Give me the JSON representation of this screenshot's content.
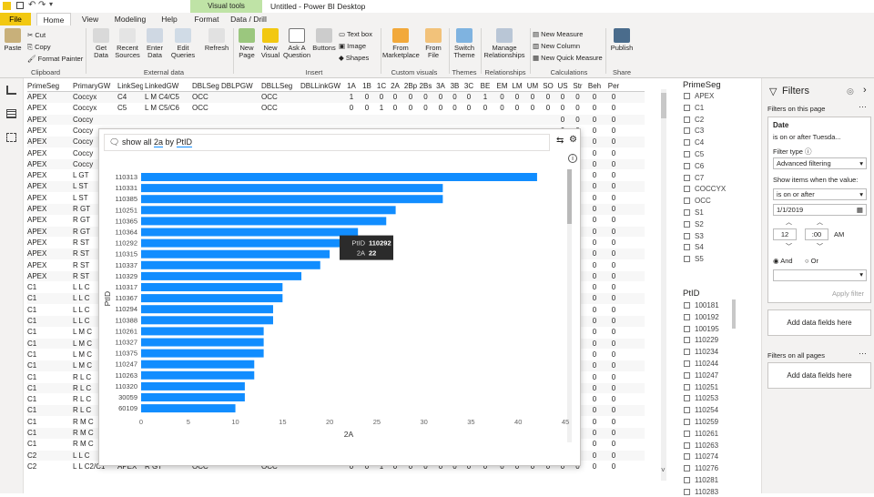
{
  "title_bar": {
    "document_title": "Untitled - Power BI Desktop",
    "visual_tools": "Visual tools"
  },
  "ribbon_tabs": [
    "File",
    "Home",
    "View",
    "Modeling",
    "Help",
    "Format",
    "Data / Drill"
  ],
  "ribbon": {
    "clipboard": {
      "paste": "Paste",
      "cut": "Cut",
      "copy": "Copy",
      "format_painter": "Format Painter",
      "group": "Clipboard"
    },
    "external": {
      "get_data": "Get Data",
      "recent": "Recent Sources",
      "enter": "Enter Data",
      "edit": "Edit Queries",
      "refresh": "Refresh",
      "group": "External data"
    },
    "insert": {
      "new_page": "New Page",
      "new_visual": "New Visual",
      "ask": "Ask A Question",
      "buttons": "Buttons",
      "text_box": "Text box",
      "image": "Image",
      "shapes": "Shapes",
      "group": "Insert"
    },
    "custom": {
      "marketplace": "From Marketplace",
      "file": "From File",
      "group": "Custom visuals"
    },
    "themes": {
      "switch": "Switch Theme",
      "group": "Themes"
    },
    "relationships": {
      "manage": "Manage Relationships",
      "group": "Relationships"
    },
    "calculations": {
      "new_measure": "New Measure",
      "new_column": "New Column",
      "new_quick": "New Quick Measure",
      "group": "Calculations"
    },
    "share": {
      "publish": "Publish",
      "group": "Share"
    }
  },
  "table": {
    "headers": [
      "PrimeSeg",
      "PrimaryGW",
      "LinkSeg",
      "LinkedGW",
      "DBLSeg",
      "DBLPGW",
      "DBLLSeg",
      "DBLLinkGW",
      "1A",
      "1B",
      "1C",
      "2A",
      "2Bp",
      "2Bs",
      "3A",
      "3B",
      "3C",
      "BE",
      "EM",
      "LM",
      "UM",
      "SO",
      "US",
      "Str",
      "Beh",
      "Per"
    ],
    "rows": [
      [
        "APEX",
        "Coccyx",
        "C4",
        "L M C4/C5",
        "OCC",
        "",
        "OCC",
        "",
        "1",
        "0",
        "0",
        "0",
        "0",
        "0",
        "0",
        "0",
        "0",
        "1",
        "0",
        "0",
        "0",
        "0",
        "0",
        "0",
        "0",
        "0"
      ],
      [
        "APEX",
        "Coccyx",
        "C5",
        "L M C5/C6",
        "OCC",
        "",
        "OCC",
        "",
        "0",
        "0",
        "1",
        "0",
        "0",
        "0",
        "0",
        "0",
        "0",
        "0",
        "0",
        "0",
        "0",
        "0",
        "0",
        "0",
        "0",
        "0"
      ],
      [
        "APEX",
        "Coccy",
        "",
        "",
        "",
        "",
        "",
        "",
        "",
        "",
        "",
        "",
        "",
        "",
        "",
        "",
        "",
        "",
        "",
        "",
        "",
        "",
        "0",
        "0",
        "0",
        "0"
      ],
      [
        "APEX",
        "Coccy",
        "",
        "",
        "",
        "",
        "",
        "",
        "",
        "",
        "",
        "",
        "",
        "",
        "",
        "",
        "",
        "",
        "",
        "",
        "",
        "",
        "0",
        "0",
        "0",
        "0"
      ],
      [
        "APEX",
        "Coccy",
        "",
        "",
        "",
        "",
        "",
        "",
        "",
        "",
        "",
        "",
        "",
        "",
        "",
        "",
        "",
        "",
        "",
        "",
        "",
        "",
        "0",
        "0",
        "0",
        "0"
      ],
      [
        "APEX",
        "Coccy",
        "",
        "",
        "",
        "",
        "",
        "",
        "",
        "",
        "",
        "",
        "",
        "",
        "",
        "",
        "",
        "",
        "",
        "",
        "",
        "",
        "0",
        "0",
        "0",
        "0"
      ],
      [
        "APEX",
        "Coccy",
        "",
        "",
        "",
        "",
        "",
        "",
        "",
        "",
        "",
        "",
        "",
        "",
        "",
        "",
        "",
        "",
        "",
        "",
        "",
        "",
        "0",
        "0",
        "0",
        "0"
      ],
      [
        "APEX",
        "L GT",
        "",
        "",
        "",
        "",
        "",
        "",
        "",
        "",
        "",
        "",
        "",
        "",
        "",
        "",
        "",
        "",
        "",
        "",
        "",
        "",
        "0",
        "0",
        "0",
        "0"
      ],
      [
        "APEX",
        "L ST",
        "",
        "",
        "",
        "",
        "",
        "",
        "",
        "",
        "",
        "",
        "",
        "",
        "",
        "",
        "",
        "",
        "",
        "",
        "",
        "",
        "0",
        "0",
        "0",
        "0"
      ],
      [
        "APEX",
        "L ST",
        "",
        "",
        "",
        "",
        "",
        "",
        "",
        "",
        "",
        "",
        "",
        "",
        "",
        "",
        "",
        "",
        "",
        "",
        "",
        "",
        "0",
        "0",
        "0",
        "0"
      ],
      [
        "APEX",
        "R GT",
        "",
        "",
        "",
        "",
        "",
        "",
        "",
        "",
        "",
        "",
        "",
        "",
        "",
        "",
        "",
        "",
        "",
        "",
        "",
        "",
        "0",
        "0",
        "0",
        "0"
      ],
      [
        "APEX",
        "R GT",
        "",
        "",
        "",
        "",
        "",
        "",
        "",
        "",
        "",
        "",
        "",
        "",
        "",
        "",
        "",
        "",
        "",
        "",
        "",
        "",
        "0",
        "0",
        "0",
        "0"
      ],
      [
        "APEX",
        "R GT",
        "",
        "",
        "",
        "",
        "",
        "",
        "",
        "",
        "",
        "",
        "",
        "",
        "",
        "",
        "",
        "",
        "",
        "",
        "",
        "",
        "0",
        "0",
        "0",
        "0"
      ],
      [
        "APEX",
        "R ST",
        "",
        "",
        "",
        "",
        "",
        "",
        "",
        "",
        "",
        "",
        "",
        "",
        "",
        "",
        "",
        "",
        "",
        "",
        "",
        "",
        "0",
        "0",
        "0",
        "0"
      ],
      [
        "APEX",
        "R ST",
        "",
        "",
        "",
        "",
        "",
        "",
        "",
        "",
        "",
        "",
        "",
        "",
        "",
        "",
        "",
        "",
        "",
        "",
        "",
        "",
        "0",
        "0",
        "0",
        "0"
      ],
      [
        "APEX",
        "R ST",
        "",
        "",
        "",
        "",
        "",
        "",
        "",
        "",
        "",
        "",
        "",
        "",
        "",
        "",
        "",
        "",
        "",
        "",
        "",
        "",
        "0",
        "0",
        "0",
        "0"
      ],
      [
        "APEX",
        "R ST",
        "",
        "",
        "",
        "",
        "",
        "",
        "",
        "",
        "",
        "",
        "",
        "",
        "",
        "",
        "",
        "",
        "",
        "",
        "",
        "",
        "0",
        "0",
        "0",
        "0"
      ],
      [
        "C1",
        "L L C",
        "",
        "",
        "",
        "",
        "",
        "",
        "",
        "",
        "",
        "",
        "",
        "",
        "",
        "",
        "",
        "",
        "",
        "",
        "",
        "",
        "0",
        "0",
        "0",
        "0"
      ],
      [
        "C1",
        "L L C",
        "",
        "",
        "",
        "",
        "",
        "",
        "",
        "",
        "",
        "",
        "",
        "",
        "",
        "",
        "",
        "",
        "",
        "",
        "",
        "",
        "0",
        "0",
        "0",
        "0"
      ],
      [
        "C1",
        "L L C",
        "",
        "",
        "",
        "",
        "",
        "",
        "",
        "",
        "",
        "",
        "",
        "",
        "",
        "",
        "",
        "",
        "",
        "",
        "",
        "",
        "0",
        "0",
        "0",
        "0"
      ],
      [
        "C1",
        "L L C",
        "",
        "",
        "",
        "",
        "",
        "",
        "",
        "",
        "",
        "",
        "",
        "",
        "",
        "",
        "",
        "",
        "",
        "",
        "",
        "",
        "0",
        "0",
        "0",
        "0"
      ],
      [
        "C1",
        "L M C",
        "",
        "",
        "",
        "",
        "",
        "",
        "",
        "",
        "",
        "",
        "",
        "",
        "",
        "",
        "",
        "",
        "",
        "",
        "",
        "",
        "0",
        "0",
        "0",
        "0"
      ],
      [
        "C1",
        "L M C",
        "",
        "",
        "",
        "",
        "",
        "",
        "",
        "",
        "",
        "",
        "",
        "",
        "",
        "",
        "",
        "",
        "",
        "",
        "",
        "",
        "0",
        "0",
        "0",
        "0"
      ],
      [
        "C1",
        "L M C",
        "",
        "",
        "",
        "",
        "",
        "",
        "",
        "",
        "",
        "",
        "",
        "",
        "",
        "",
        "",
        "",
        "",
        "",
        "",
        "",
        "0",
        "0",
        "0",
        "0"
      ],
      [
        "C1",
        "L M C",
        "",
        "",
        "",
        "",
        "",
        "",
        "",
        "",
        "",
        "",
        "",
        "",
        "",
        "",
        "",
        "",
        "",
        "",
        "",
        "",
        "0",
        "0",
        "0",
        "0"
      ],
      [
        "C1",
        "R L C",
        "",
        "",
        "",
        "",
        "",
        "",
        "",
        "",
        "",
        "",
        "",
        "",
        "",
        "",
        "",
        "",
        "",
        "",
        "",
        "",
        "0",
        "0",
        "0",
        "0"
      ],
      [
        "C1",
        "R L C",
        "",
        "",
        "",
        "",
        "",
        "",
        "",
        "",
        "",
        "",
        "",
        "",
        "",
        "",
        "",
        "",
        "",
        "",
        "",
        "",
        "0",
        "0",
        "0",
        "0"
      ],
      [
        "C1",
        "R L C",
        "",
        "",
        "",
        "",
        "",
        "",
        "",
        "",
        "",
        "",
        "",
        "",
        "",
        "",
        "",
        "",
        "",
        "",
        "",
        "",
        "0",
        "0",
        "0",
        "0"
      ],
      [
        "C1",
        "R L C",
        "",
        "",
        "",
        "",
        "",
        "",
        "",
        "",
        "",
        "",
        "",
        "",
        "",
        "",
        "",
        "",
        "",
        "",
        "",
        "",
        "0",
        "0",
        "0",
        "0"
      ],
      [
        "C1",
        "R M C",
        "",
        "",
        "",
        "",
        "",
        "",
        "",
        "",
        "",
        "",
        "",
        "",
        "",
        "",
        "",
        "",
        "",
        "",
        "",
        "",
        "0",
        "0",
        "0",
        "0"
      ],
      [
        "C1",
        "R M C",
        "",
        "",
        "",
        "",
        "",
        "",
        "",
        "",
        "",
        "",
        "",
        "",
        "",
        "",
        "",
        "",
        "",
        "",
        "",
        "",
        "0",
        "0",
        "0",
        "0"
      ],
      [
        "C1",
        "R M C",
        "",
        "",
        "",
        "",
        "",
        "",
        "",
        "",
        "",
        "",
        "",
        "",
        "",
        "",
        "",
        "",
        "",
        "",
        "",
        "",
        "0",
        "0",
        "0",
        "0"
      ],
      [
        "C2",
        "L L C",
        "",
        "",
        "",
        "",
        "",
        "",
        "",
        "",
        "",
        "",
        "",
        "",
        "",
        "",
        "",
        "",
        "",
        "",
        "",
        "",
        "0",
        "0",
        "0",
        "0"
      ],
      [
        "C2",
        "L L C2/C1",
        "APEX",
        "R GT",
        "OCC",
        "",
        "OCC",
        "",
        "0",
        "0",
        "1",
        "0",
        "0",
        "0",
        "0",
        "0",
        "0",
        "0",
        "0",
        "0",
        "0",
        "0",
        "0",
        "0",
        "0",
        "0"
      ]
    ]
  },
  "qa": {
    "query_prefix": "show all",
    "query_measure": "2a",
    "query_by": "by",
    "query_field": "PtID"
  },
  "chart_data": {
    "type": "bar",
    "orientation": "horizontal",
    "categories": [
      "110313",
      "110331",
      "110385",
      "110251",
      "110365",
      "110364",
      "110292",
      "110315",
      "110337",
      "110329",
      "110317",
      "110367",
      "110294",
      "110388",
      "110261",
      "110327",
      "110375",
      "110247",
      "110263",
      "110320",
      "30059",
      "60109"
    ],
    "values": [
      42,
      32,
      32,
      27,
      26,
      23,
      22,
      20,
      19,
      17,
      15,
      15,
      14,
      14,
      13,
      13,
      13,
      12,
      12,
      11,
      11,
      10
    ],
    "xlabel": "2A",
    "ylabel": "PtID",
    "xlim": [
      0,
      45
    ],
    "xticks": [
      0,
      5,
      10,
      15,
      20,
      25,
      30,
      35,
      40,
      45
    ],
    "bar_color": "#118DFF",
    "tooltip": {
      "field1": "PtID",
      "value1": "110292",
      "field2": "2A",
      "value2": "22"
    }
  },
  "slicer_primeseg": {
    "title": "PrimeSeg",
    "items": [
      "APEX",
      "C1",
      "C2",
      "C3",
      "C4",
      "C5",
      "C6",
      "C7",
      "COCCYX",
      "OCC",
      "S1",
      "S2",
      "S3",
      "S4",
      "S5"
    ]
  },
  "slicer_ptid": {
    "title": "PtID",
    "items": [
      "100181",
      "100192",
      "100195",
      "110229",
      "110234",
      "110244",
      "110247",
      "110251",
      "110253",
      "110254",
      "110259",
      "110261",
      "110263",
      "110274",
      "110276",
      "110281",
      "110283"
    ]
  },
  "filters": {
    "title": "Filters",
    "on_this_page": "Filters on this page",
    "card_field": "Date",
    "card_summary": "is on or after Tuesda...",
    "filter_type_label": "Filter type",
    "filter_type_value": "Advanced filtering",
    "show_items_label": "Show items when the value:",
    "condition": "is on or after",
    "date_value": "1/1/2019",
    "hour": "12",
    "minute": "00",
    "ampm": "AM",
    "and_label": "And",
    "or_label": "Or",
    "apply": "Apply filter",
    "add_fields": "Add data fields here",
    "on_all_pages": "Filters on all pages",
    "add_fields2": "Add data fields here"
  }
}
